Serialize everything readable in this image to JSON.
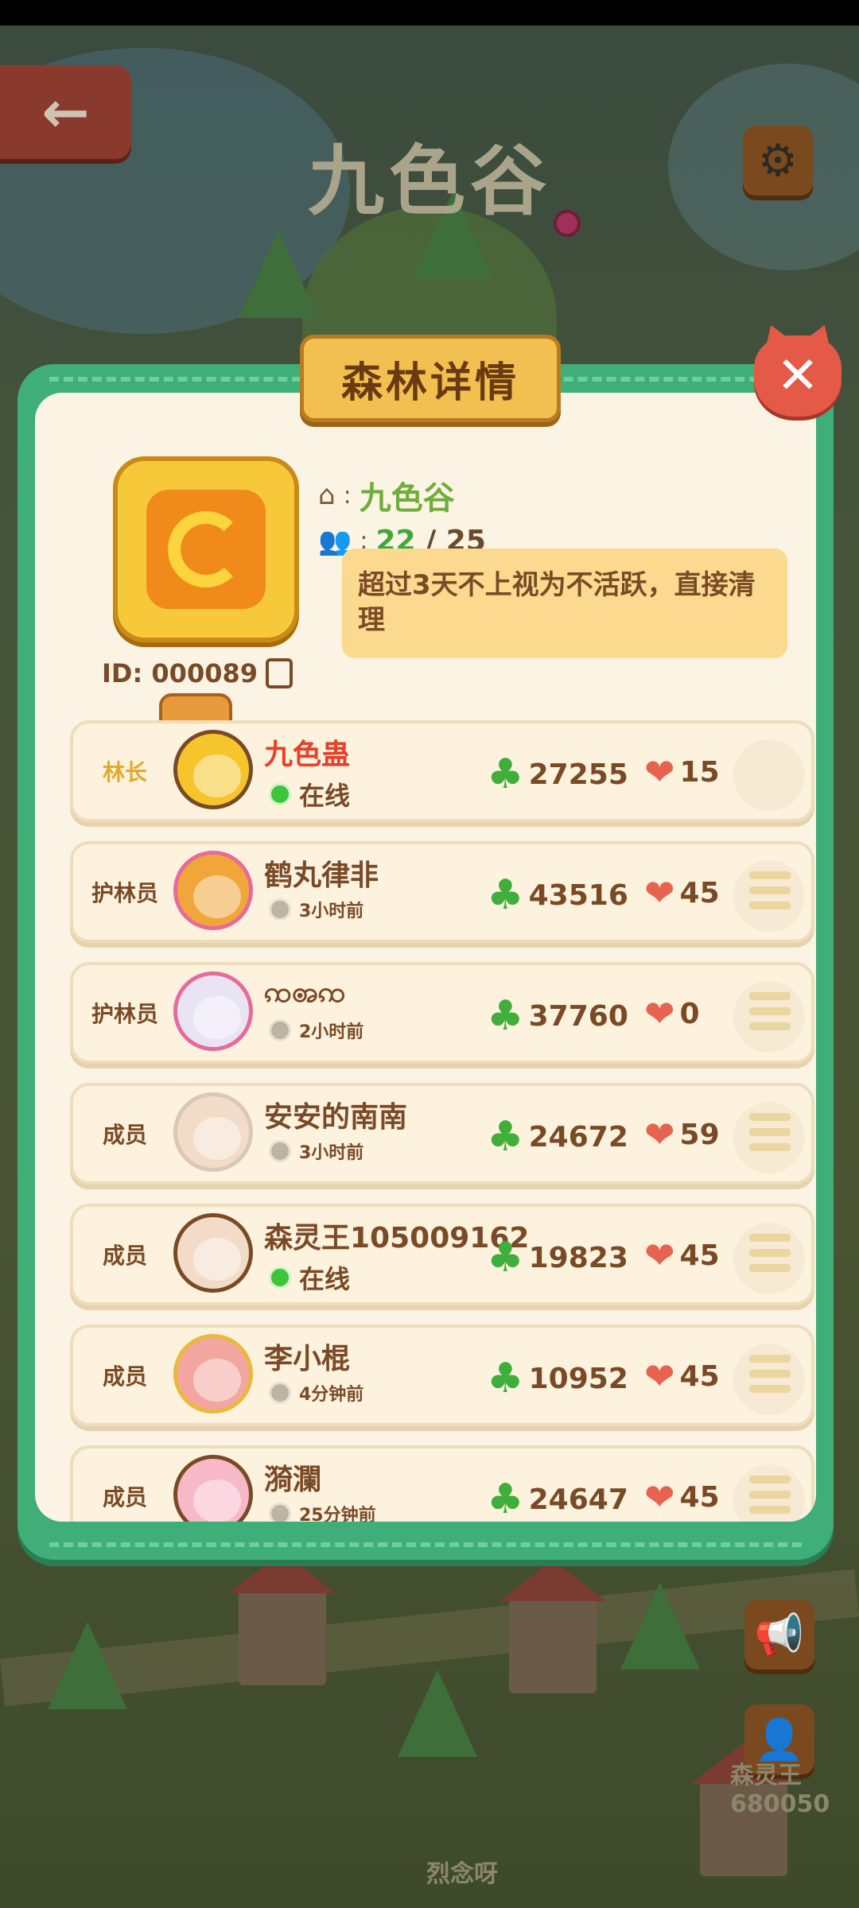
{
  "scene": {
    "title": "九色谷",
    "back_icon": "left-arrow-icon",
    "settings_icon": "gear-icon",
    "bottom_player_1": "森灵王680050",
    "bottom_player_2": "烈念呀"
  },
  "dialog": {
    "title": "森林详情",
    "close_label": "✕",
    "forest": {
      "id_label": "ID: 000089",
      "name": "九色谷",
      "members_current": "22",
      "members_max": " / 25",
      "notice": "超过3天不上视为不活跃，直接清理",
      "exit_label": "⇥"
    },
    "members": [
      {
        "role": "林长",
        "name": "九色蛊",
        "status": "在线",
        "online": true,
        "clovers": "27255",
        "hearts": "15"
      },
      {
        "role": "护林员",
        "name": "鹤丸律非",
        "status": "3小时前",
        "online": false,
        "clovers": "43516",
        "hearts": "45"
      },
      {
        "role": "护林员",
        "name": "ꩡꩨꩡ",
        "status": "2小时前",
        "online": false,
        "clovers": "37760",
        "hearts": "0"
      },
      {
        "role": "成员",
        "name": "安安的南南",
        "status": "3小时前",
        "online": false,
        "clovers": "24672",
        "hearts": "59"
      },
      {
        "role": "成员",
        "name": "森灵王105009162",
        "status": "在线",
        "online": true,
        "clovers": "19823",
        "hearts": "45"
      },
      {
        "role": "成员",
        "name": "李小棍",
        "status": "4分钟前",
        "online": false,
        "clovers": "10952",
        "hearts": "45"
      },
      {
        "role": "成员",
        "name": "漪瀾",
        "status": "25分钟前",
        "online": false,
        "clovers": "24647",
        "hearts": "45"
      }
    ]
  },
  "colors": {
    "panel_green": "#3fae79",
    "banner_gold": "#f2c050",
    "leader_name_red": "#e5412a",
    "online_green": "#3dc43a"
  }
}
